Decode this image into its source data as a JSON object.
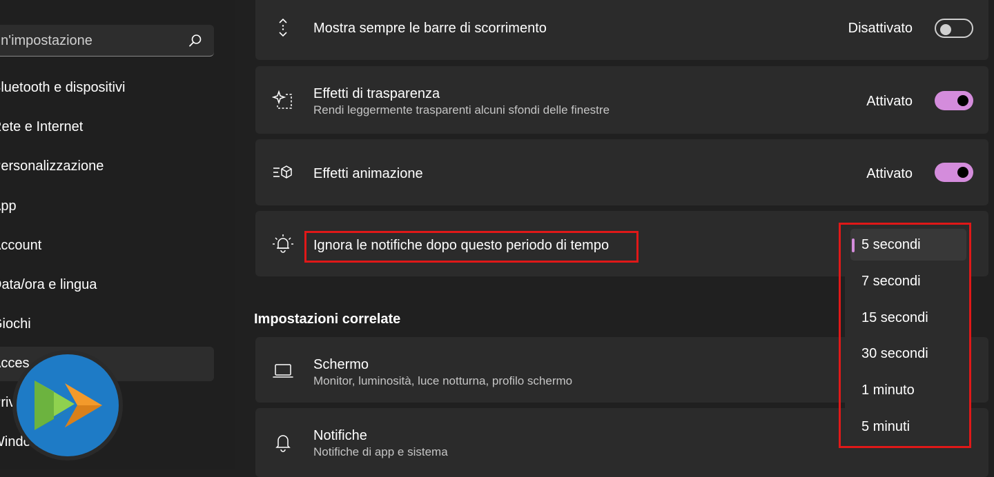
{
  "sidebar": {
    "search_text": "un'impostazione",
    "items": [
      {
        "label": "Bluetooth e dispositivi"
      },
      {
        "label": "Rete e Internet"
      },
      {
        "label": "Personalizzazione"
      },
      {
        "label": "App"
      },
      {
        "label": "Account"
      },
      {
        "label": "Data/ora e lingua"
      },
      {
        "label": "Giochi"
      },
      {
        "label": "Acces"
      },
      {
        "label": "Priv"
      },
      {
        "label": "Windo"
      }
    ]
  },
  "settings": {
    "scrollbars": {
      "icon": "scroll-arrows-icon",
      "title": "Mostra sempre le barre di scorrimento",
      "state": "Disattivato",
      "enabled": false
    },
    "transparency": {
      "icon": "sparkle-selection-icon",
      "title": "Effetti di trasparenza",
      "subtitle": "Rendi leggermente trasparenti alcuni sfondi delle finestre",
      "state": "Attivato",
      "enabled": true
    },
    "animation": {
      "icon": "animation-effects-icon",
      "title": "Effetti animazione",
      "state": "Attivato",
      "enabled": true
    },
    "notifications_timeout": {
      "icon": "notification-bell-icon",
      "title": "Ignora le notifiche dopo questo periodo di tempo"
    }
  },
  "related": {
    "heading": "Impostazioni correlate",
    "items": [
      {
        "icon": "laptop-icon",
        "title": "Schermo",
        "subtitle": "Monitor, luminosità, luce notturna, profilo schermo"
      },
      {
        "icon": "bell-icon",
        "title": "Notifiche",
        "subtitle": "Notifiche di app e sistema"
      }
    ]
  },
  "dropdown": {
    "selected_index": 0,
    "options": [
      "5 secondi",
      "7 secondi",
      "15 secondi",
      "30 secondi",
      "1 minuto",
      "5 minuti"
    ]
  },
  "colors": {
    "accent": "#d48cdc",
    "annotation": "#e01818",
    "logo_blue": "#1e7bc6",
    "logo_green": "#6cb33f",
    "logo_orange": "#f39a2b"
  }
}
